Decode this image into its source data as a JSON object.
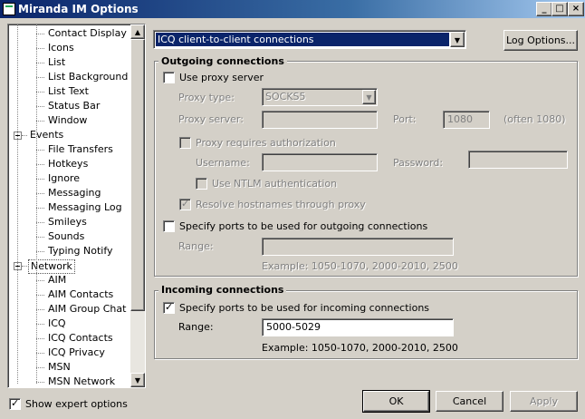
{
  "window": {
    "title": "Miranda IM Options"
  },
  "tree": {
    "items": [
      {
        "label": "Contact Display",
        "indent": 2
      },
      {
        "label": "Icons",
        "indent": 2
      },
      {
        "label": "List",
        "indent": 2
      },
      {
        "label": "List Background",
        "indent": 2
      },
      {
        "label": "List Text",
        "indent": 2
      },
      {
        "label": "Status Bar",
        "indent": 2
      },
      {
        "label": "Window",
        "indent": 2
      },
      {
        "label": "Events",
        "indent": 1
      },
      {
        "label": "File Transfers",
        "indent": 2
      },
      {
        "label": "Hotkeys",
        "indent": 2
      },
      {
        "label": "Ignore",
        "indent": 2
      },
      {
        "label": "Messaging",
        "indent": 2
      },
      {
        "label": "Messaging Log",
        "indent": 2
      },
      {
        "label": "Smileys",
        "indent": 2
      },
      {
        "label": "Sounds",
        "indent": 2
      },
      {
        "label": "Typing Notify",
        "indent": 2
      },
      {
        "label": "Network",
        "indent": 1,
        "selected": true
      },
      {
        "label": "AIM",
        "indent": 2
      },
      {
        "label": "AIM Contacts",
        "indent": 2
      },
      {
        "label": "AIM Group Chat",
        "indent": 2
      },
      {
        "label": "ICQ",
        "indent": 2
      },
      {
        "label": "ICQ Contacts",
        "indent": 2
      },
      {
        "label": "ICQ Privacy",
        "indent": 2
      },
      {
        "label": "MSN",
        "indent": 2
      },
      {
        "label": "MSN Network",
        "indent": 2
      }
    ]
  },
  "show_expert": {
    "label": "Show expert options",
    "checked": true
  },
  "connection_select": {
    "value": "ICQ client-to-client connections"
  },
  "log_options_button": "Log Options...",
  "outgoing": {
    "title": "Outgoing connections",
    "use_proxy": {
      "label": "Use proxy server",
      "checked": false
    },
    "proxy_type_label": "Proxy type:",
    "proxy_type_value": "SOCKS5",
    "proxy_server_label": "Proxy server:",
    "proxy_server_value": "",
    "port_label": "Port:",
    "port_value": "1080",
    "port_hint": "(often 1080)",
    "requires_auth": {
      "label": "Proxy requires authorization",
      "checked": false
    },
    "username_label": "Username:",
    "password_label": "Password:",
    "ntlm": {
      "label": "Use NTLM authentication",
      "checked": false
    },
    "resolve": {
      "label": "Resolve hostnames through proxy",
      "checked": true
    },
    "specify_ports": {
      "label": "Specify ports to be used for outgoing connections",
      "checked": false
    },
    "range_label": "Range:",
    "range_value": "",
    "example": "Example: 1050-1070, 2000-2010, 2500"
  },
  "incoming": {
    "title": "Incoming connections",
    "specify_ports": {
      "label": "Specify ports to be used for incoming connections",
      "checked": true
    },
    "range_label": "Range:",
    "range_value": "5000-5029",
    "example": "Example: 1050-1070, 2000-2010, 2500"
  },
  "buttons": {
    "ok": "OK",
    "cancel": "Cancel",
    "apply": "Apply"
  },
  "caption_buttons": {
    "minimize": "_",
    "maximize": "□",
    "close": "×"
  },
  "colors": {
    "titlebar_start": "#0a246a",
    "face": "#d4d0c8",
    "selection": "#0a246a"
  }
}
